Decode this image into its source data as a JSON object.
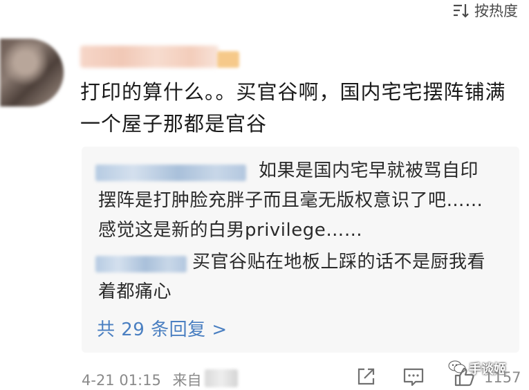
{
  "sort": {
    "label": "按热度"
  },
  "comment": {
    "text": "打印的算什么。。买官谷啊，国内宅宅摆阵铺满一个屋子那都是官谷",
    "time": "4-21 01:15",
    "source_prefix": "来自",
    "like_count": "1157"
  },
  "replies": {
    "items": [
      {
        "text": "如果是国内宅早就被骂自印摆阵是打肿脸充胖子而且毫无版权意识了吧……感觉这是新的白男privilege……"
      },
      {
        "text": "买官谷贴在地板上踩的话不是厨我看着都痛心"
      }
    ],
    "more_label": "共 29 条回复 >"
  },
  "watermark": {
    "text": "手谈姬"
  },
  "icons": {
    "sort": "sort-icon",
    "share": "share-icon",
    "reply": "comment-icon",
    "like": "thumbs-up-icon",
    "watermark": "wechat-icon"
  },
  "colors": {
    "link": "#4a7fc1",
    "reply_bg": "#f7f7f7",
    "meta": "#8a8a8a"
  }
}
